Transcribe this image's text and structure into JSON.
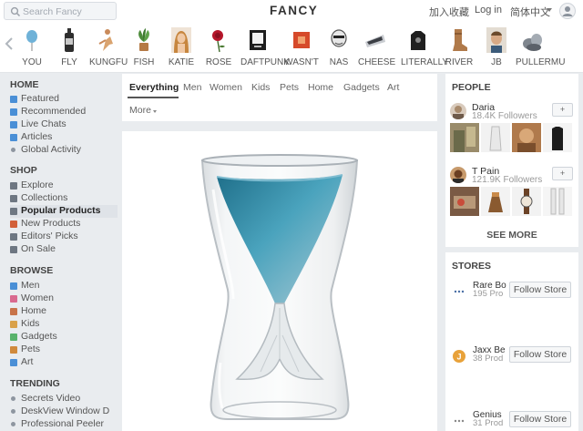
{
  "header": {
    "search_placeholder": "Search Fancy",
    "logo": "FANCY",
    "join": "加入",
    "favorites": "收藏",
    "login": "Log in",
    "language": "简体中文"
  },
  "categories": [
    {
      "label": "YOU",
      "icon": "balloon-icon"
    },
    {
      "label": "FLY",
      "icon": "bottle-icon"
    },
    {
      "label": "KUNGFU",
      "icon": "kungfu-figure-icon"
    },
    {
      "label": "FISH",
      "icon": "plant-icon"
    },
    {
      "label": "KATIE",
      "icon": "woman-portrait-icon"
    },
    {
      "label": "ROSE",
      "icon": "rose-icon"
    },
    {
      "label": "DAFTPUNK",
      "icon": "album-icon"
    },
    {
      "label": "WASN'T",
      "icon": "red-square-icon"
    },
    {
      "label": "NAS",
      "icon": "man-portrait-icon"
    },
    {
      "label": "CHEESE",
      "icon": "cheese-icon"
    },
    {
      "label": "LITERALLY",
      "icon": "shirt-icon"
    },
    {
      "label": "RIVER",
      "icon": "boot-icon"
    },
    {
      "label": "JB",
      "icon": "man-glasses-icon"
    },
    {
      "label": "PULLERMU",
      "icon": "rocks-icon"
    }
  ],
  "sidebar": {
    "sections": [
      {
        "title": "HOME",
        "items": [
          {
            "label": "Featured",
            "marker": "square",
            "color": "#4a8fd6"
          },
          {
            "label": "Recommended",
            "marker": "square",
            "color": "#4a8fd6"
          },
          {
            "label": "Live Chats",
            "marker": "square",
            "color": "#4a8fd6"
          },
          {
            "label": "Articles",
            "marker": "square",
            "color": "#4a8fd6"
          },
          {
            "label": "Global Activity",
            "marker": "dot",
            "color": "#8e96a0"
          }
        ]
      },
      {
        "title": "SHOP",
        "items": [
          {
            "label": "Explore",
            "marker": "square",
            "color": "#6e7782"
          },
          {
            "label": "Collections",
            "marker": "square",
            "color": "#6e7782"
          },
          {
            "label": "Popular Products",
            "marker": "square",
            "color": "#6e7782",
            "active": true
          },
          {
            "label": "New Products",
            "marker": "square",
            "color": "#d2603a"
          },
          {
            "label": "Editors' Picks",
            "marker": "square",
            "color": "#6e7782"
          },
          {
            "label": "On Sale",
            "marker": "square",
            "color": "#6e7782"
          }
        ]
      },
      {
        "title": "BROWSE",
        "items": [
          {
            "label": "Men",
            "marker": "square",
            "color": "#4a8fd6"
          },
          {
            "label": "Women",
            "marker": "square",
            "color": "#d96a8f"
          },
          {
            "label": "Home",
            "marker": "square",
            "color": "#c8744a"
          },
          {
            "label": "Kids",
            "marker": "square",
            "color": "#d9a14a"
          },
          {
            "label": "Gadgets",
            "marker": "square",
            "color": "#59b36b"
          },
          {
            "label": "Pets",
            "marker": "square",
            "color": "#d08a3c"
          },
          {
            "label": "Art",
            "marker": "square",
            "color": "#4a8fd6"
          }
        ]
      },
      {
        "title": "TRENDING",
        "items": [
          {
            "label": "Secrets Video",
            "marker": "dot",
            "color": "#8e96a0"
          },
          {
            "label": "DeskView Window D",
            "marker": "dot",
            "color": "#8e96a0"
          },
          {
            "label": "Professional Peeler",
            "marker": "dot",
            "color": "#8e96a0"
          }
        ]
      }
    ]
  },
  "main": {
    "tabs": [
      "Everything",
      "Men",
      "Women",
      "Kids",
      "Pets",
      "Home",
      "Gadgets",
      "Art"
    ],
    "active_tab": "Everything",
    "more_label": "More"
  },
  "people": {
    "title": "PEOPLE",
    "follow_label": "+",
    "list": [
      {
        "name": "Daria",
        "followers": "18.4K Followers"
      },
      {
        "name": "T Pain",
        "followers": "121.9K Followers"
      }
    ],
    "see_more": "SEE MORE"
  },
  "stores": {
    "title": "STORES",
    "follow_label": "Follow Store",
    "list": [
      {
        "name": "Rare Bo",
        "products": "195 Pro"
      },
      {
        "name": "Jaxx Be",
        "products": "38 Prod"
      },
      {
        "name": "Genius",
        "products": "31 Prod"
      }
    ]
  },
  "colors": {
    "accent": "#4a8fd6",
    "page_bg": "#e9ecef",
    "panel_bg": "#ffffff"
  }
}
